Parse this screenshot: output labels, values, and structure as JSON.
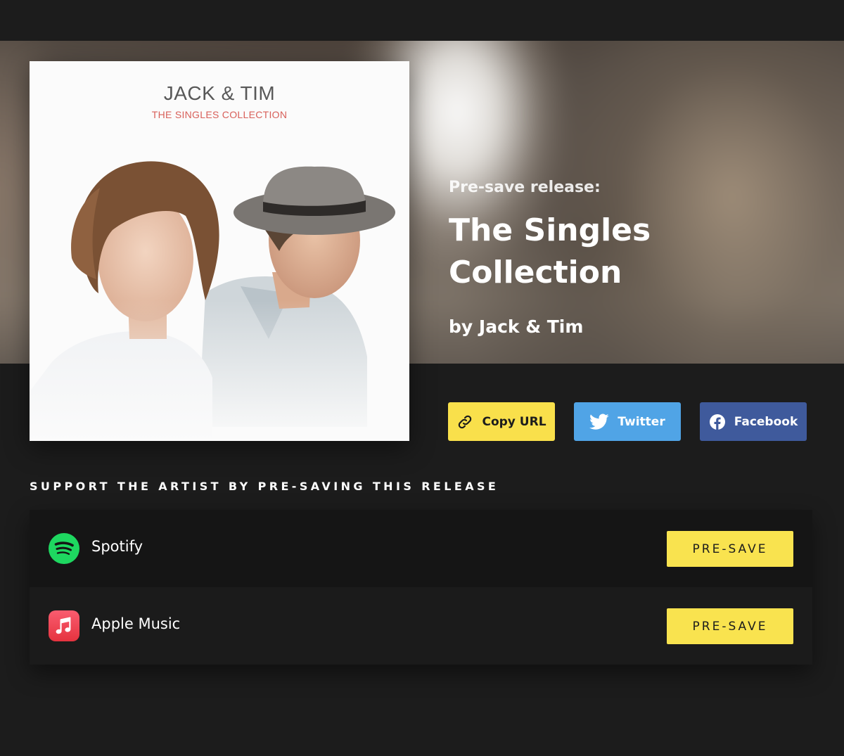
{
  "hero": {
    "prelabel": "Pre-save release:",
    "title": "The Singles Collection",
    "byline": "by Jack & Tim"
  },
  "cover": {
    "artist": "JACK & TIM",
    "subtitle": "THE SINGLES COLLECTION"
  },
  "share": {
    "copy_label": "Copy URL",
    "copy_icon": "link-icon",
    "twitter_label": "Twitter",
    "twitter_icon": "twitter-bird-icon",
    "facebook_label": "Facebook",
    "facebook_icon": "facebook-icon"
  },
  "support_heading": "SUPPORT THE ARTIST BY PRE-SAVING THIS RELEASE",
  "services": [
    {
      "name": "Spotify",
      "icon": "spotify-icon",
      "button": "PRE-SAVE"
    },
    {
      "name": "Apple Music",
      "icon": "apple-music-icon",
      "button": "PRE-SAVE"
    }
  ],
  "colors": {
    "accent_yellow": "#f9e04b",
    "twitter_blue": "#50a4e6",
    "facebook_blue": "#3f5a9c",
    "spotify_green": "#1ed760",
    "apple_music_red": "#f2485c",
    "background": "#1c1c1c"
  }
}
